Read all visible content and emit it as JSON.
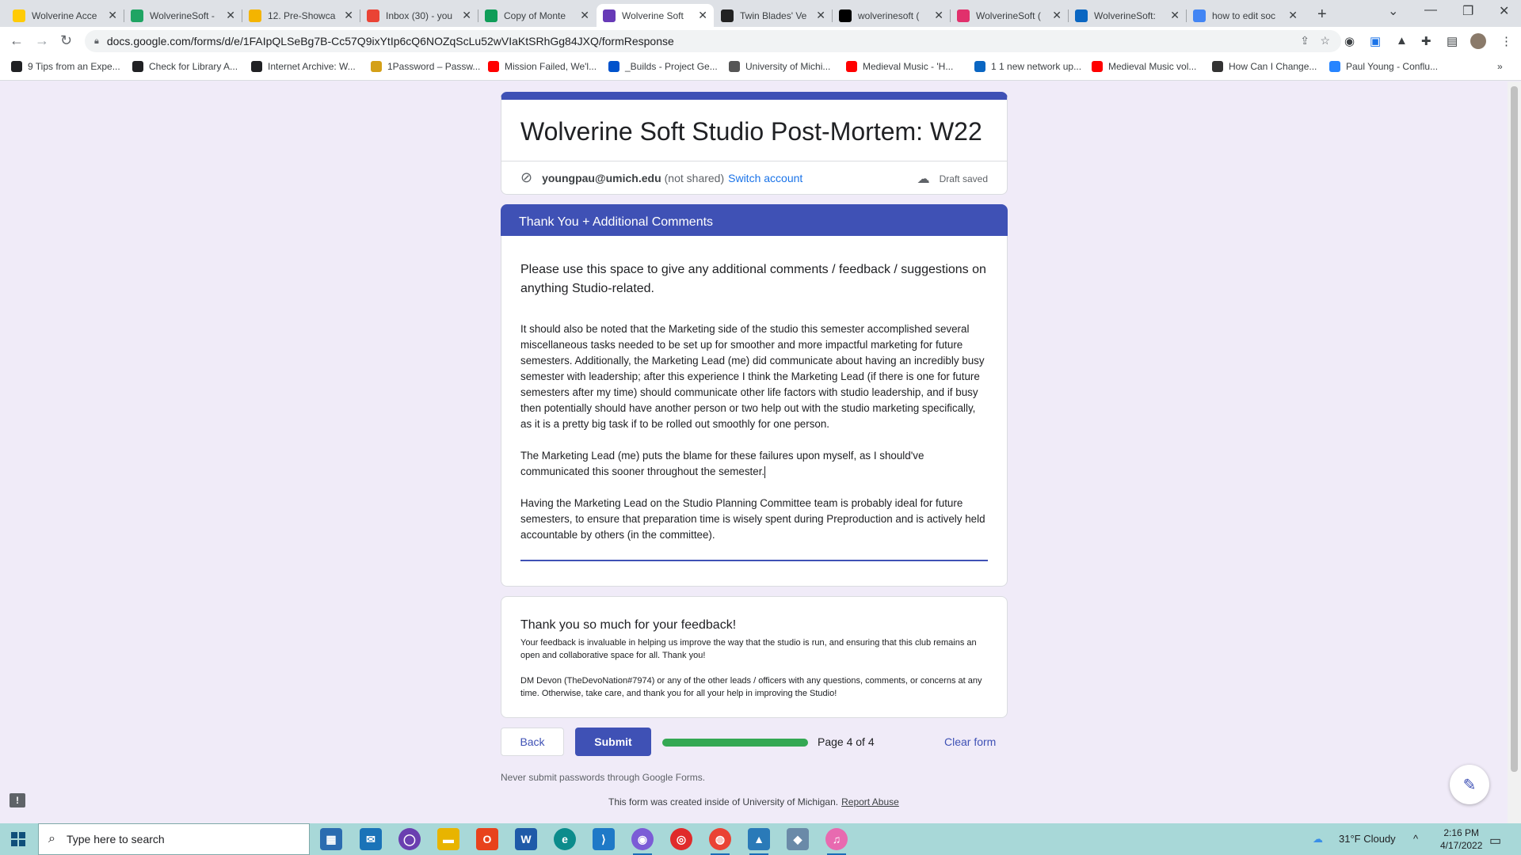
{
  "browser": {
    "tabs": [
      {
        "title": "Wolverine Acce",
        "icon": "umich-icon",
        "color": "#ffcb05"
      },
      {
        "title": "WolverineSoft -",
        "icon": "google-drive-icon",
        "color": "#1fa463"
      },
      {
        "title": "12. Pre-Showca",
        "icon": "google-slides-icon",
        "color": "#f4b400"
      },
      {
        "title": "Inbox (30) - you",
        "icon": "gmail-icon",
        "color": "#ea4335"
      },
      {
        "title": "Copy of Monte",
        "icon": "google-sheets-icon",
        "color": "#0f9d58"
      },
      {
        "title": "Wolverine Soft",
        "icon": "google-forms-icon",
        "color": "#673ab7",
        "active": true
      },
      {
        "title": "Twin Blades' Ve",
        "icon": "twin-blades-icon",
        "color": "#222222"
      },
      {
        "title": "wolverinesoft (",
        "icon": "tiktok-icon",
        "color": "#000000"
      },
      {
        "title": "WolverineSoft (",
        "icon": "instagram-icon",
        "color": "#e1306c"
      },
      {
        "title": "WolverineSoft: ",
        "icon": "linkedin-icon",
        "color": "#0a66c2"
      },
      {
        "title": "how to edit soc",
        "icon": "google-icon",
        "color": "#4285f4"
      }
    ],
    "url": "docs.google.com/forms/d/e/1FAIpQLSeBg7B-Cc57Q9ixYtIp6cQ6NOZqScLu52wVIaKtSRhGg84JXQ/formResponse",
    "bookmarks": [
      {
        "label": "9 Tips from an Expe...",
        "color": "#202124"
      },
      {
        "label": "Check for Library A...",
        "color": "#202124"
      },
      {
        "label": "Internet Archive: W...",
        "color": "#202124"
      },
      {
        "label": "1Password – Passw...",
        "color": "#d4a017"
      },
      {
        "label": "Mission Failed, We'l...",
        "color": "#ff0000"
      },
      {
        "label": "_Builds - Project Ge...",
        "color": "#0052cc"
      },
      {
        "label": "University of Michi...",
        "color": "#555555"
      },
      {
        "label": "Medieval Music - 'H...",
        "color": "#ff0000"
      },
      {
        "label": "1 1 new network up...",
        "color": "#0a66c2"
      },
      {
        "label": "Medieval Music vol...",
        "color": "#ff0000"
      },
      {
        "label": "How Can I Change...",
        "color": "#333333"
      },
      {
        "label": "Paul Young - Conflu...",
        "color": "#2684ff"
      }
    ]
  },
  "form": {
    "title": "Wolverine Soft Studio Post-Mortem: W22",
    "account_email": "youngpau@umich.edu",
    "not_shared": "(not shared)",
    "switch_account": "Switch account",
    "draft_status": "Draft saved",
    "section_title": "Thank You + Additional Comments",
    "question": "Please use this space to give any additional comments / feedback / suggestions on anything Studio-related.",
    "answer_paragraphs": [
      "It should also be noted that the Marketing side of the studio this semester accomplished several miscellaneous tasks needed to be set up for smoother and more impactful marketing for future semesters. Additionally, the Marketing Lead (me) did communicate about having an incredibly busy semester with leadership; after this experience I think the Marketing Lead (if there is one for future semesters after my time) should communicate other life factors with studio leadership, and if busy then potentially should have another person or two help out with the studio marketing specifically, as it is a pretty big task if to be rolled out smoothly for one person.",
      "The Marketing Lead (me) puts the blame for these failures upon myself, as I should've communicated this sooner throughout the semester.",
      "Having the Marketing Lead on the Studio Planning Committee team is probably ideal for future semesters, to ensure that preparation time is wisely spent during Preproduction and is actively held accountable by others (in the committee)."
    ],
    "thanks_heading": "Thank you so much for your feedback!",
    "thanks_p1": "Your feedback is invaluable in helping us improve the way that the studio is run, and ensuring that this club remains an open and collaborative space for all. Thank you!",
    "thanks_p2": "DM Devon (TheDevoNation#7974) or any of the other leads / officers with any questions, comments, or concerns at any time. Otherwise, take care, and thank you for all your help in improving the Studio!",
    "back_label": "Back",
    "submit_label": "Submit",
    "progress_fraction": 1.0,
    "page_indicator": "Page 4 of 4",
    "clear_label": "Clear form",
    "never_submit": "Never submit passwords through Google Forms.",
    "created_inside": "This form was created inside of University of Michigan.",
    "report_abuse": "Report Abuse",
    "accent_color": "#3f51b5"
  },
  "taskbar": {
    "search_placeholder": "Type here to search",
    "weather": "31°F  Cloudy",
    "time": "2:16 PM",
    "date": "4/17/2022"
  }
}
